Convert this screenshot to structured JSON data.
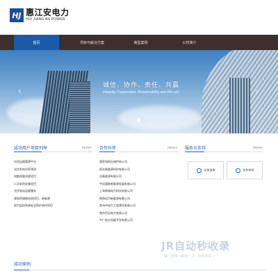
{
  "brand": {
    "logo_mark": "HJ",
    "name_cn": "惠江安电力",
    "name_en": "HUI JIANG AN POWER"
  },
  "nav": {
    "items": [
      {
        "label": "首页"
      },
      {
        "label": "项目与解决方案"
      },
      {
        "label": "典型案例"
      },
      {
        "label": "公司简介"
      }
    ]
  },
  "banner": {
    "slogan": "诚信、协作、责任、共赢",
    "slogan_en": "Integrity, Cooperation, Responsibility and Win-win",
    "prev": "‹",
    "next": "›"
  },
  "sections": {
    "projects": {
      "title": "成功用户项目列举",
      "more": "more+",
      "items": [
        "光伏运维管理平台",
        "光伏发电功率预测",
        "电能质量治理项目",
        "二次安防实施项目",
        "光伏电站运维服务",
        "源网荷储微电网项目、新能源",
        "电力监控系统安全防护测评项目"
      ]
    },
    "partners": {
      "title": "合作伙伴",
      "more": "more+",
      "items": [
        "国家电网无锡供电公司",
        "阳光新能源科技有限公司",
        "迅泰能源有限公司",
        "中设国联新能源发展有限公司",
        "上海南瑞电力科技有限公司",
        "德昌电力新能源有限公司",
        "常州市电力工程建设有限公司",
        "南京世纪电力有限公司",
        "中广核太阳能开发有限公司"
      ]
    },
    "services": {
      "title": "服务与支持",
      "more": "more+",
      "boxes": [
        {
          "label": "业务咨询"
        },
        {
          "label": "合作伙伴"
        }
      ]
    },
    "cases": {
      "title": "成功案例"
    }
  },
  "watermark": {
    "main": "JR自动秒收录",
    "sub": "做上链接→来访一次→自动收录→"
  },
  "colors": {
    "accent": "#1d63b8",
    "nav_bg": "#3d2f2c",
    "nav_active": "#1b5aa8"
  }
}
